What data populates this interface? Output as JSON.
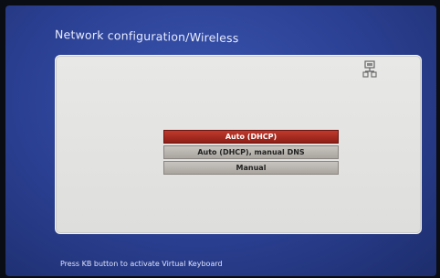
{
  "header": {
    "title": "Network configuration/Wireless"
  },
  "status_icon": {
    "name": "network-icon"
  },
  "menu": {
    "items": [
      {
        "label": "Auto (DHCP)",
        "selected": true
      },
      {
        "label": "Auto (DHCP), manual DNS",
        "selected": false
      },
      {
        "label": "Manual",
        "selected": false
      }
    ]
  },
  "footer": {
    "hint": "Press KB button to activate Virtual Keyboard"
  },
  "colors": {
    "background": "#2a3f91",
    "panel": "#e3e3e1",
    "selected": "#a62b20",
    "unselected": "#b9b5b0"
  }
}
